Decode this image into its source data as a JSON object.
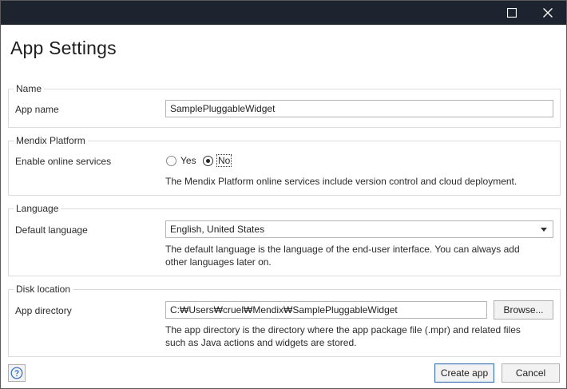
{
  "window": {
    "maximize_icon": "maximize-icon",
    "close_icon": "close-icon"
  },
  "dialog": {
    "title": "App Settings"
  },
  "name_group": {
    "legend": "Name",
    "app_name_label": "App name",
    "app_name_value": "SamplePluggableWidget"
  },
  "platform_group": {
    "legend": "Mendix Platform",
    "online_label": "Enable online services",
    "options": [
      {
        "label": "Yes",
        "selected": false
      },
      {
        "label": "No",
        "selected": true
      }
    ],
    "help": "The Mendix Platform online services include version control and cloud deployment."
  },
  "language_group": {
    "legend": "Language",
    "default_label": "Default language",
    "selected_language": "English, United States",
    "help_line1": "The default language is the language of the end-user interface. You can always add",
    "help_line2": "other languages later on."
  },
  "disk_group": {
    "legend": "Disk location",
    "dir_label": "App directory",
    "dir_value": "C:₩Users₩cruel₩Mendix₩SamplePluggableWidget",
    "browse_label": "Browse...",
    "help_line1": "The app directory is the directory where the app package file (.mpr) and related files",
    "help_line2": "such as Java actions and widgets are stored."
  },
  "footer": {
    "help_icon": "help-icon",
    "create_label": "Create app",
    "cancel_label": "Cancel"
  },
  "colors": {
    "titlebar": "#1e2330",
    "primary_border": "#3a6fb0",
    "help_icon": "#2f6cc2"
  }
}
